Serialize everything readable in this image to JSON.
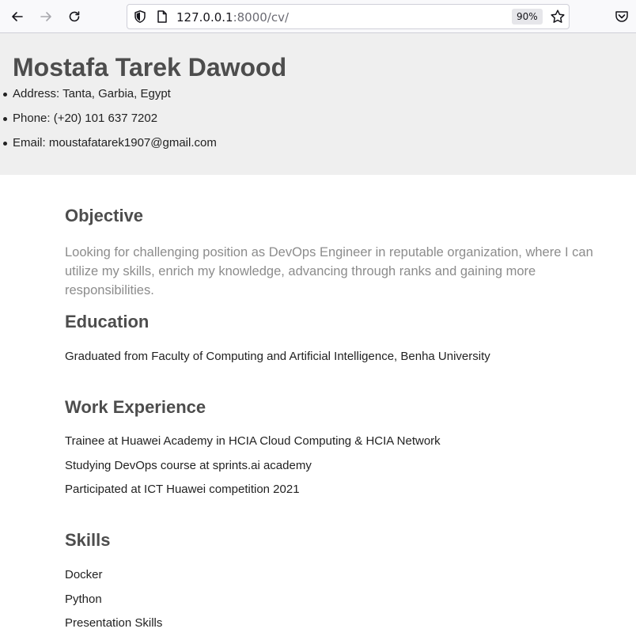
{
  "browser": {
    "url_host": "127.0.0.1",
    "url_rest": ":8000/cv/",
    "zoom": "90%"
  },
  "header": {
    "name": "Mostafa Tarek Dawood",
    "contacts": [
      "Address: Tanta, Garbia, Egypt",
      "Phone: (+20) 101 637 7202",
      "Email: moustafatarek1907@gmail.com"
    ]
  },
  "objective": {
    "title": "Objective",
    "text": "Looking for challenging position as DevOps Engineer in reputable organization, where I can utilize my skills, enrich my knowledge, advancing through ranks and gaining more responsibilities."
  },
  "education": {
    "title": "Education",
    "text": "Graduated from Faculty of Computing and Artificial Intelligence, Benha University"
  },
  "work": {
    "title": "Work Experience",
    "items": [
      "Trainee at Huawei Academy in HCIA Cloud Computing & HCIA Network",
      "Studying DevOps course at sprints.ai academy",
      "Participated at ICT Huawei competition 2021"
    ]
  },
  "skills": {
    "title": "Skills",
    "items": [
      "Docker",
      "Python",
      "Presentation Skills"
    ]
  }
}
